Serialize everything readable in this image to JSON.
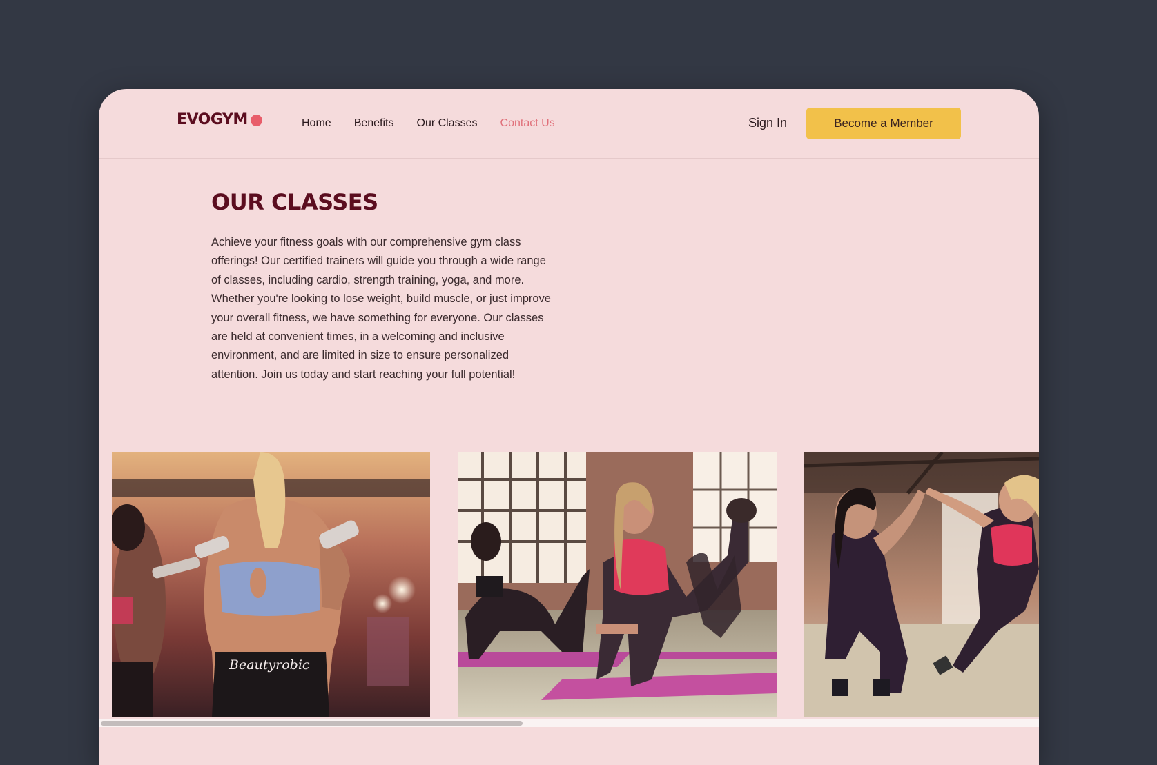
{
  "brand": {
    "name": "EVOGYM",
    "dot_color": "#e85d6a"
  },
  "nav": {
    "links": [
      {
        "label": "Home"
      },
      {
        "label": "Benefits"
      },
      {
        "label": "Our Classes"
      },
      {
        "label": "Contact Us",
        "active": true
      }
    ],
    "sign_in": "Sign In",
    "cta": "Become a Member"
  },
  "section": {
    "title": "OUR CLASSES",
    "description": "Achieve your fitness goals with our comprehensive gym class offerings! Our certified trainers will guide you through a wide range of classes, including cardio, strength training, yoga, and more. Whether you're looking to lose weight, build muscle, or just improve your overall fitness, we have something for everyone. Our classes are held at convenient times, in a welcoming and inclusive environment, and are limited in size to ensure personalized attention. Join us today and start reaching your full potential!"
  },
  "gallery": {
    "photos": [
      {
        "name": "dumbbell-class-photo",
        "shirt_text": "Beautyrobic"
      },
      {
        "name": "mat-workout-class-photo"
      },
      {
        "name": "high-five-class-photo"
      }
    ]
  },
  "colors": {
    "background": "#333844",
    "page": "#f5dbdc",
    "accent": "#f2c14a",
    "primary_text": "#5b0d1f",
    "active_link": "#e0707a"
  }
}
